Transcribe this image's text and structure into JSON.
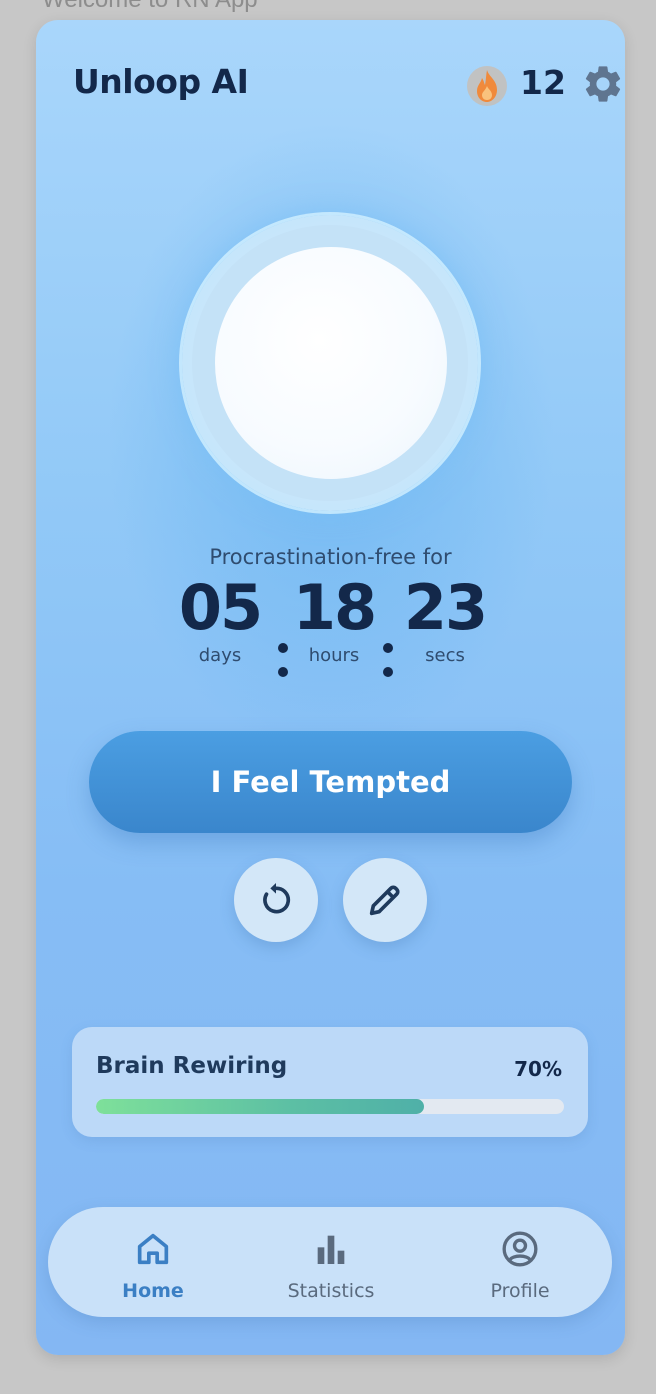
{
  "outer": {
    "title": "Welcome to RN App"
  },
  "header": {
    "app_title": "Unloop AI",
    "streak_count": "12"
  },
  "timer": {
    "label": "Procrastination-free for",
    "units": [
      {
        "value": "05",
        "label": "days"
      },
      {
        "value": "18",
        "label": "hours"
      },
      {
        "value": "23",
        "label": "secs"
      }
    ]
  },
  "actions": {
    "tempted_label": "I Feel Tempted"
  },
  "progress": {
    "title": "Brain Rewiring",
    "percent_text": "70%",
    "value": 0.7
  },
  "nav": {
    "items": [
      {
        "label": "Home",
        "icon": "home-icon",
        "active": true
      },
      {
        "label": "Statistics",
        "icon": "bar-chart-icon",
        "active": false
      },
      {
        "label": "Profile",
        "icon": "profile-icon",
        "active": false
      }
    ]
  },
  "colors": {
    "text_dark": "#13284a",
    "accent_blue": "#3b7fc4",
    "flame_orange": "#f08a3c",
    "progress_green": "#7ee09a"
  }
}
